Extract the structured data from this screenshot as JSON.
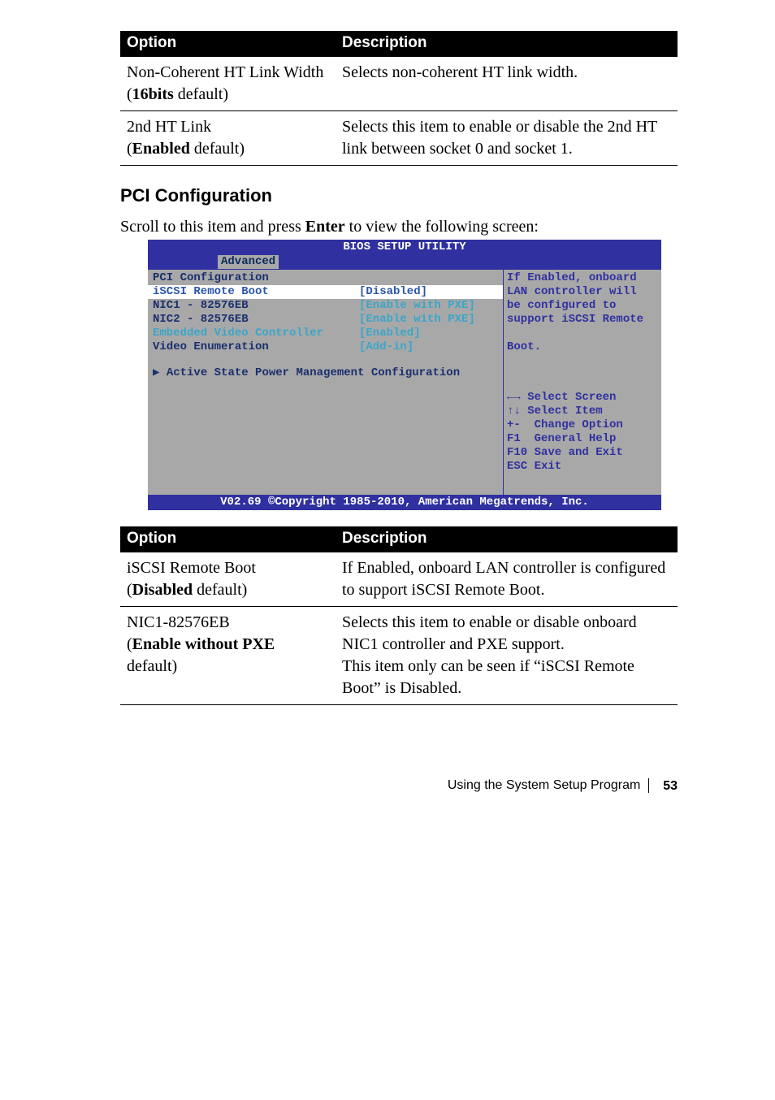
{
  "tables": {
    "top": {
      "headers": {
        "opt": "Option",
        "desc": "Description"
      },
      "rows": [
        {
          "opt_line1": "Non-Coherent HT Link Width",
          "opt_line2": "(",
          "opt_bold": "16bits",
          "opt_line2_tail": " default)",
          "desc": "Selects non-coherent HT link width."
        },
        {
          "opt_line1": "2nd HT Link",
          "opt_line2": "(",
          "opt_bold": "Enabled",
          "opt_line2_tail": " default)",
          "desc": "Selects this item to enable or disable the 2nd HT link between socket 0 and socket 1."
        }
      ]
    },
    "bottom": {
      "headers": {
        "opt": "Option",
        "desc": "Description"
      },
      "rows": [
        {
          "opt_line1": "iSCSI Remote Boot",
          "opt_line2": "(",
          "opt_bold": "Disabled",
          "opt_line2_tail": " default)",
          "desc": "If Enabled, onboard LAN controller is configured to support iSCSI Remote Boot."
        },
        {
          "opt_line1": "NIC1-82576EB",
          "opt_line2": "(",
          "opt_bold": "Enable without PXE",
          "opt_line2_tail": " default)",
          "desc_l1": "Selects this item to enable or disable onboard NIC1 controller and PXE support.",
          "desc_l2": "This item only can be seen if “iSCSI Remote Boot” is Disabled."
        }
      ]
    }
  },
  "section": {
    "head": "PCI Configuration",
    "intro_pre": "Scroll to this item and press ",
    "intro_bold": "Enter",
    "intro_post": " to view the following screen:"
  },
  "bios": {
    "title": "BIOS SETUP UTILITY",
    "tab": "Advanced",
    "left": {
      "sec": "PCI Configuration",
      "r1": {
        "lab": "iSCSI Remote Boot",
        "val": "[Disabled]"
      },
      "r2": {
        "lab": "NIC1 - 82576EB",
        "val": "[Enable with PXE]"
      },
      "r3": {
        "lab": "NIC2 - 82576EB",
        "val": "[Enable with PXE]"
      },
      "r4": {
        "lab": "Embedded Video Controller",
        "val": "[Enabled]"
      },
      "r5": {
        "lab": "Video Enumeration",
        "val": "[Add-in]"
      },
      "sub": "▶ Active State Power Management Configuration"
    },
    "right": {
      "help1": "If Enabled, onboard",
      "help2": "LAN controller will",
      "help3": "be configured to",
      "help4": "support iSCSI Remote",
      "help5": "",
      "help6": "Boot.",
      "k1": "←→ Select Screen",
      "k2": "↑↓ Select Item",
      "k3": "+-  Change Option",
      "k4": "F1  General Help",
      "k5": "F10 Save and Exit",
      "k6": "ESC Exit"
    },
    "status": "V02.69 ©Copyright 1985-2010, American Megatrends, Inc."
  },
  "footer": {
    "text": "Using the System Setup Program",
    "page": "53"
  }
}
